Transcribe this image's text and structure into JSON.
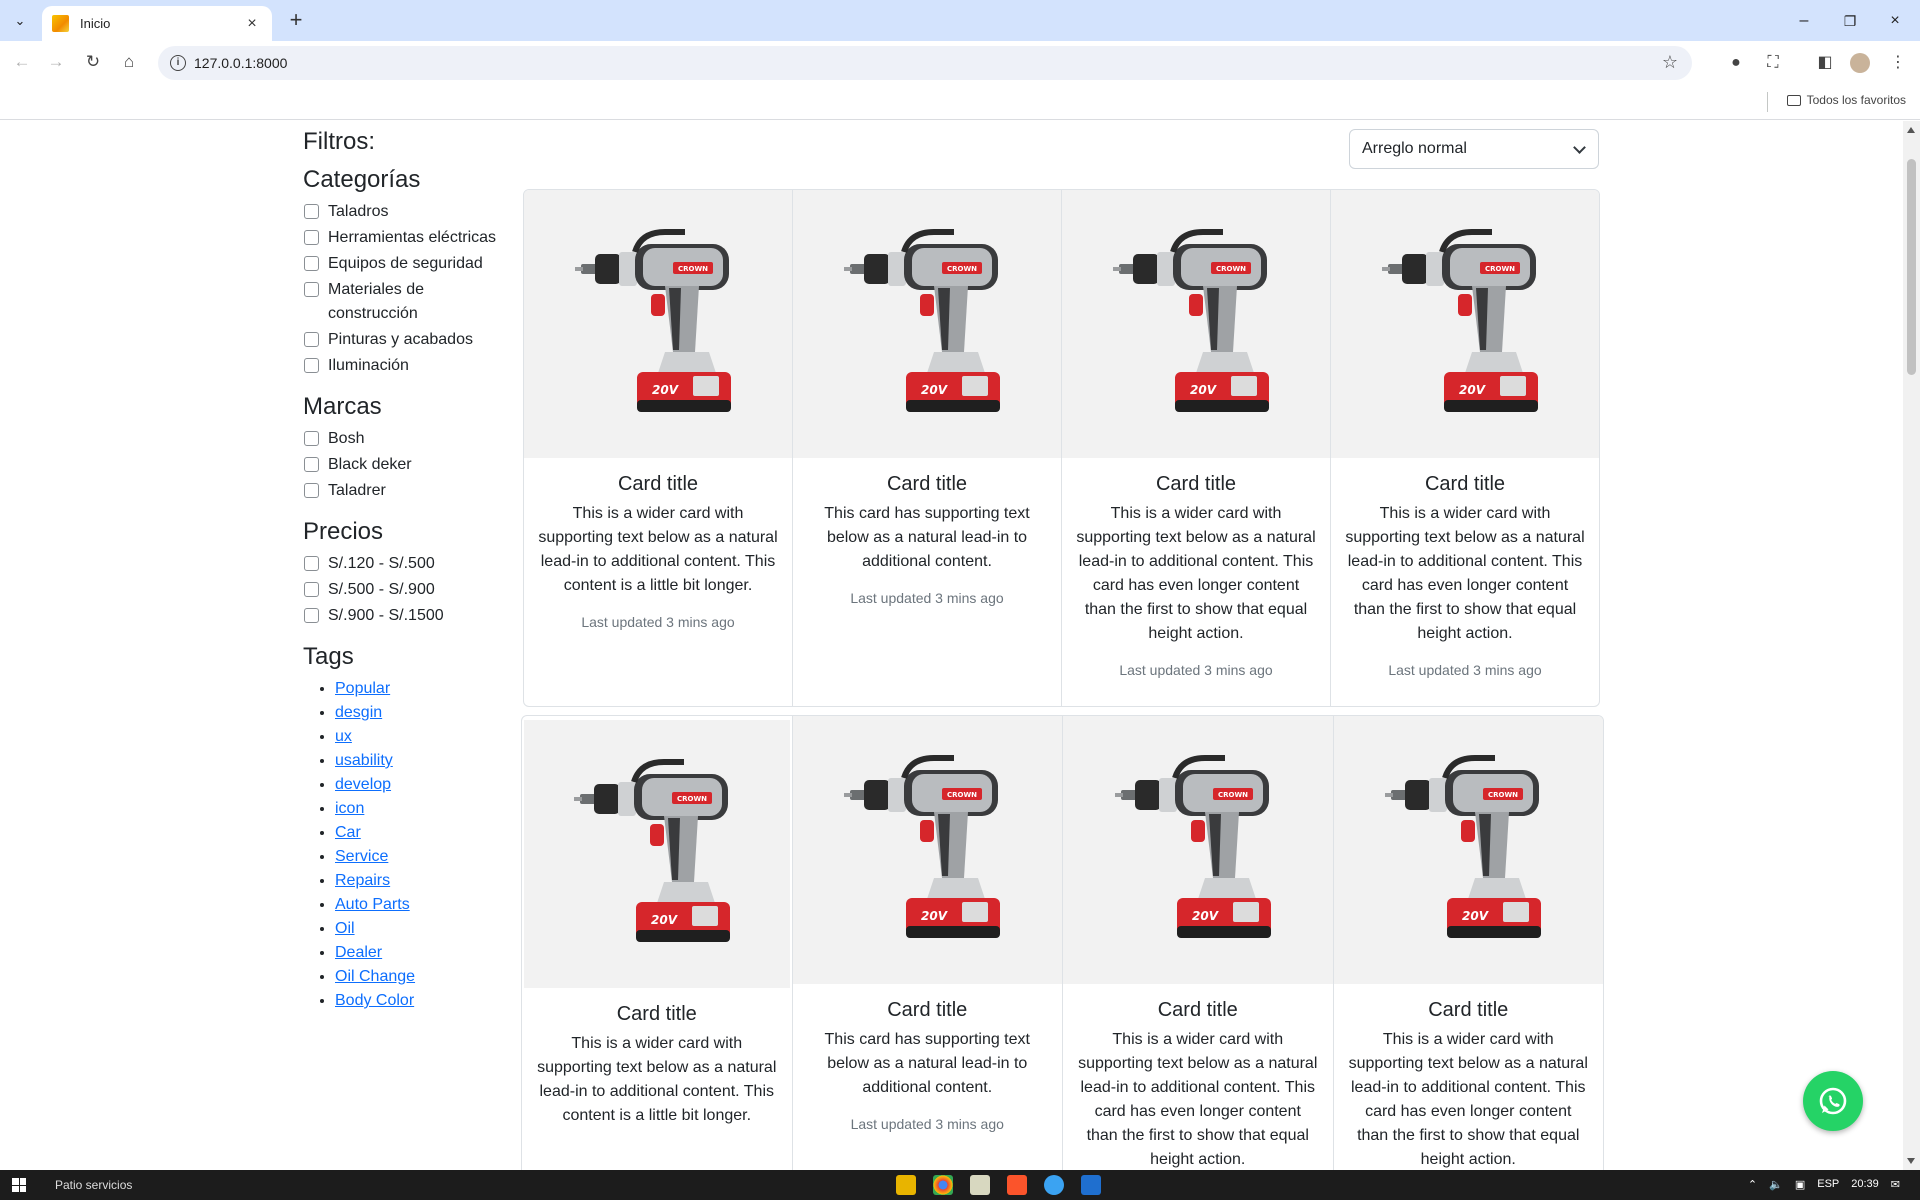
{
  "browser": {
    "tab_title": "Inicio",
    "url": "127.0.0.1:8000",
    "bookmarks_label": "Todos los favoritos"
  },
  "page": {
    "filters_title": "Filtros:",
    "sort": {
      "selected": "Arreglo normal"
    },
    "categories": {
      "title": "Categorías",
      "items": [
        "Taladros",
        "Herramientas eléctricas",
        "Equipos de seguridad",
        "Materiales de construcción",
        "Pinturas y acabados",
        "Iluminación"
      ]
    },
    "brands": {
      "title": "Marcas",
      "items": [
        "Bosh",
        "Black deker",
        "Taladrer"
      ]
    },
    "prices": {
      "title": "Precios",
      "items": [
        "S/.120 - S/.500",
        "S/.500 - S/.900",
        "S/.900 - S/.1500"
      ]
    },
    "tags": {
      "title": "Tags",
      "items": [
        "Popular",
        "desgin",
        "ux",
        "usability",
        "develop",
        "icon",
        "Car",
        "Service",
        "Repairs",
        "Auto Parts",
        "Oil",
        "Dealer",
        "Oil Change",
        "Body Color"
      ]
    },
    "card_groups": [
      [
        {
          "title": "Card title",
          "text": "This is a wider card with supporting text below as a natural lead-in to additional content. This content is a little bit longer.",
          "updated": "Last updated 3 mins ago"
        },
        {
          "title": "Card title",
          "text": "This card has supporting text below as a natural lead-in to additional content.",
          "updated": "Last updated 3 mins ago"
        },
        {
          "title": "Card title",
          "text": "This is a wider card with supporting text below as a natural lead-in to additional content. This card has even longer content than the first to show that equal height action.",
          "updated": "Last updated 3 mins ago"
        },
        {
          "title": "Card title",
          "text": "This is a wider card with supporting text below as a natural lead-in to additional content. This card has even longer content than the first to show that equal height action.",
          "updated": "Last updated 3 mins ago"
        }
      ],
      [
        {
          "title": "Card title",
          "text": "This is a wider card with supporting text below as a natural lead-in to additional content. This content is a little bit longer.",
          "updated": ""
        },
        {
          "title": "Card title",
          "text": "This card has supporting text below as a natural lead-in to additional content.",
          "updated": "Last updated 3 mins ago"
        },
        {
          "title": "Card title",
          "text": "This is a wider card with supporting text below as a natural lead-in to additional content. This card has even longer content than the first to show that equal height action.",
          "updated": ""
        },
        {
          "title": "Card title",
          "text": "This is a wider card with supporting text below as a natural lead-in to additional content. This card has even longer content than the first to show that equal height action.",
          "updated": ""
        }
      ]
    ],
    "product_image_brand": "CROWN"
  },
  "taskbar": {
    "search_label": "Patio servicios",
    "language": "ESP",
    "time": "20:39"
  },
  "colors": {
    "link": "#0d6efd",
    "whatsapp": "#25d366",
    "drill_red": "#d6262b",
    "drill_gray": "#b9bcbf"
  }
}
